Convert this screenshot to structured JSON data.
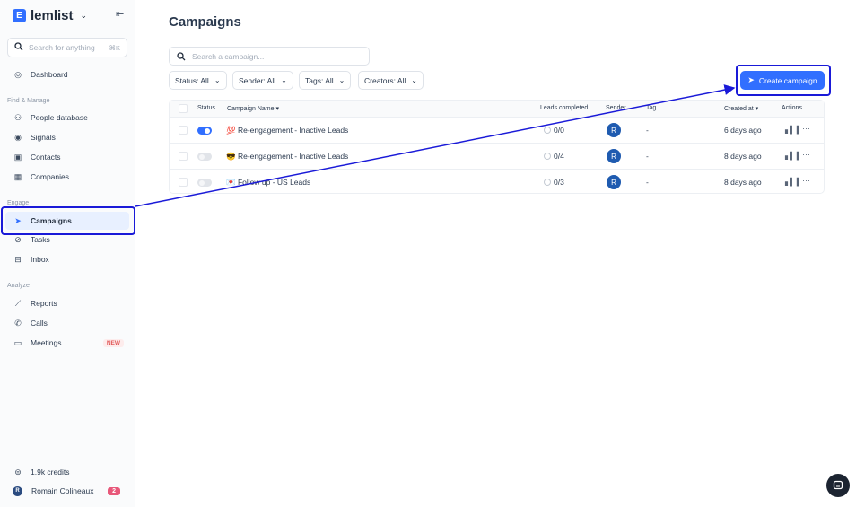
{
  "brand": {
    "name": "lemlist",
    "logo": "E"
  },
  "search": {
    "placeholder": "Search for anything",
    "shortcut": "⌘K"
  },
  "nav": {
    "dashboard": "Dashboard",
    "section_find": "Find & Manage",
    "people_database": "People database",
    "signals": "Signals",
    "contacts": "Contacts",
    "companies": "Companies",
    "section_engage": "Engage",
    "campaigns": "Campaigns",
    "tasks": "Tasks",
    "inbox": "Inbox",
    "section_analyze": "Analyze",
    "reports": "Reports",
    "calls": "Calls",
    "meetings": "Meetings",
    "meetings_badge": "NEW",
    "credits": "1.9k credits",
    "user_name": "Romain Colineaux",
    "user_initial": "R",
    "user_badge": "2"
  },
  "main": {
    "title": "Campaigns",
    "search_placeholder": "Search a campaign...",
    "filters": [
      "Status: All",
      "Sender: All",
      "Tags: All",
      "Creators: All"
    ],
    "create_label": "Create campaign"
  },
  "table": {
    "headers": {
      "status": "Status",
      "name": "Campaign Name",
      "leads": "Leads completed",
      "sender": "Sender",
      "tag": "Tag",
      "created": "Created at",
      "actions": "Actions"
    },
    "rows": [
      {
        "emoji": "💯",
        "name": "Re-engagement - Inactive Leads",
        "active": true,
        "leads": "0/0",
        "sender": "R",
        "tag": "-",
        "created": "6 days ago"
      },
      {
        "emoji": "😎",
        "name": "Re-engagement - Inactive Leads",
        "active": false,
        "leads": "0/4",
        "sender": "R",
        "tag": "-",
        "created": "8 days ago"
      },
      {
        "emoji": "💌",
        "name": "Follow up - US Leads",
        "active": false,
        "leads": "0/3",
        "sender": "R",
        "tag": "-",
        "created": "8 days ago"
      }
    ]
  },
  "colors": {
    "accent": "#316fff",
    "highlight": "#1a1ad8"
  }
}
